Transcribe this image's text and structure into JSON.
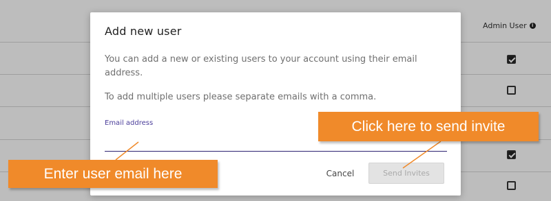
{
  "background_table": {
    "column_header": "Admin User",
    "info_icon": "info-icon",
    "checkbox_states": [
      true,
      false,
      true,
      false
    ]
  },
  "modal": {
    "title": "Add new user",
    "description_1": "You can add a new or existing users to your account using their email address.",
    "description_2": "To add multiple users please separate emails with a comma.",
    "email_label": "Email address",
    "email_value": "",
    "cancel_label": "Cancel",
    "send_label": "Send Invites"
  },
  "callouts": {
    "invite": "Click here to send invite",
    "email": "Enter user email here"
  },
  "colors": {
    "callout": "#f08a2a",
    "field_label": "#4a3d9a",
    "input_underline": "#2a2170"
  }
}
